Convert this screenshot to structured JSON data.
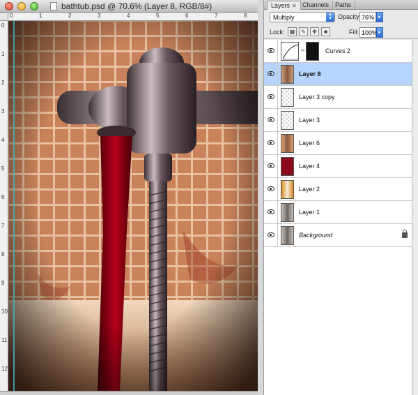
{
  "document": {
    "title": "bathtub.psd @ 70.6% (Layer 8, RGB/8#)",
    "ruler_top": [
      "0",
      "1",
      "2",
      "3",
      "4",
      "5",
      "6",
      "7",
      "8"
    ],
    "ruler_left": [
      "0",
      "1",
      "2",
      "3",
      "4",
      "5",
      "6",
      "7",
      "8",
      "9",
      "10",
      "11",
      "12"
    ]
  },
  "panel": {
    "tabs": [
      {
        "label": "Layers",
        "close": "✕"
      },
      {
        "label": "Channels"
      },
      {
        "label": "Paths"
      }
    ],
    "blend_mode": "Multiply",
    "opacity_label": "Opacity:",
    "opacity_value": "76%",
    "lock_label": "Lock:",
    "fill_label": "Fill:",
    "fill_value": "100%",
    "layers": [
      {
        "name": "Curves 2",
        "selected": false,
        "thumb": "curves"
      },
      {
        "name": "Layer 8",
        "selected": true,
        "thumb": "photo"
      },
      {
        "name": "Layer 3 copy",
        "selected": false,
        "thumb": "transparent"
      },
      {
        "name": "Layer 3",
        "selected": false,
        "thumb": "transparent"
      },
      {
        "name": "Layer 6",
        "selected": false,
        "thumb": "photo"
      },
      {
        "name": "Layer 4",
        "selected": false,
        "thumb": "red"
      },
      {
        "name": "Layer 2",
        "selected": false,
        "thumb": "orange"
      },
      {
        "name": "Layer 1",
        "selected": false,
        "thumb": "gray"
      },
      {
        "name": "Background",
        "selected": false,
        "thumb": "gray",
        "locked": true
      }
    ]
  },
  "colors": {
    "selection": "#b5d5ff",
    "guide": "#3fb8c8",
    "tile": "#c9825a",
    "liquid": "#8a0010"
  }
}
